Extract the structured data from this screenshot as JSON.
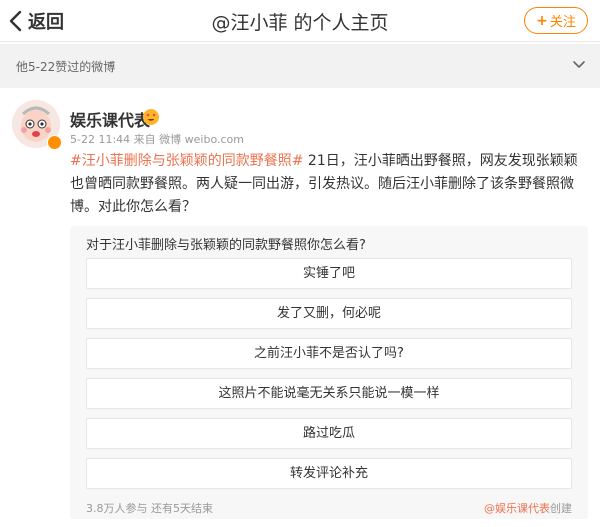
{
  "header": {
    "back_label": "返回",
    "title": "@汪小菲 的个人主页",
    "follow_label": "关注",
    "follow_plus": "+"
  },
  "section": {
    "label": "他5-22赞过的微博"
  },
  "post": {
    "username": "娱乐课代表",
    "time": "5-22 11:44",
    "source": "来自 微博 weibo.com",
    "topic": "#汪小菲删除与张颖颖的同款野餐照#",
    "body": " 21日，汪小菲晒出野餐照，网友发现张颖颖也曾晒同款野餐照。两人疑一同出游，引发热议。随后汪小菲删除了该条野餐照微博。对此你怎么看？"
  },
  "vote": {
    "question": "对于汪小菲删除与张颖颖的同款野餐照你怎么看?",
    "options": [
      "实锤了吧",
      "发了又删，何必呢",
      "之前汪小菲不是否认了吗?",
      "这照片不能说毫无关系只能说一模一样",
      "路过吃瓜",
      "转发评论补充"
    ],
    "stats": "3.8万人参与 还有5天结束",
    "creator_handle": "@娱乐课代表",
    "creator_suffix": "创建"
  },
  "colors": {
    "accent": "#ff8200",
    "topic": "#eb7350",
    "muted": "#999999"
  }
}
